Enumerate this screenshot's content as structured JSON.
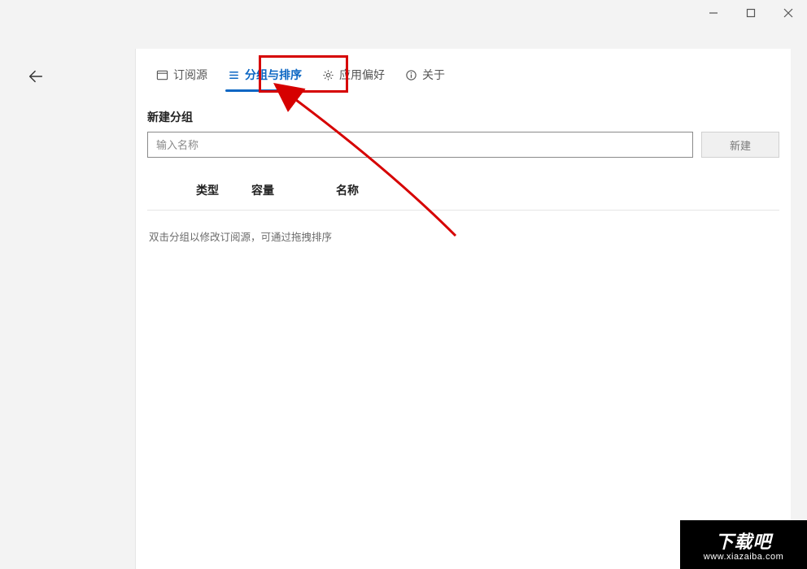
{
  "titlebar": {
    "minimize_tip": "Minimize",
    "maximize_tip": "Maximize",
    "close_tip": "Close"
  },
  "back": {
    "label": "Back"
  },
  "tabs": {
    "sources": {
      "label": "订阅源"
    },
    "grouping": {
      "label": "分组与排序"
    },
    "preferences": {
      "label": "应用偏好"
    },
    "about": {
      "label": "关于"
    },
    "active": "grouping"
  },
  "create": {
    "title": "新建分组",
    "placeholder": "输入名称",
    "value": "",
    "button": "新建"
  },
  "columns": {
    "type": "类型",
    "capacity": "容量",
    "name": "名称"
  },
  "hint": "双击分组以修改订阅源，可通过拖拽排序",
  "watermark": {
    "brand": "下载吧",
    "url": "www.xiazaiba.com"
  }
}
